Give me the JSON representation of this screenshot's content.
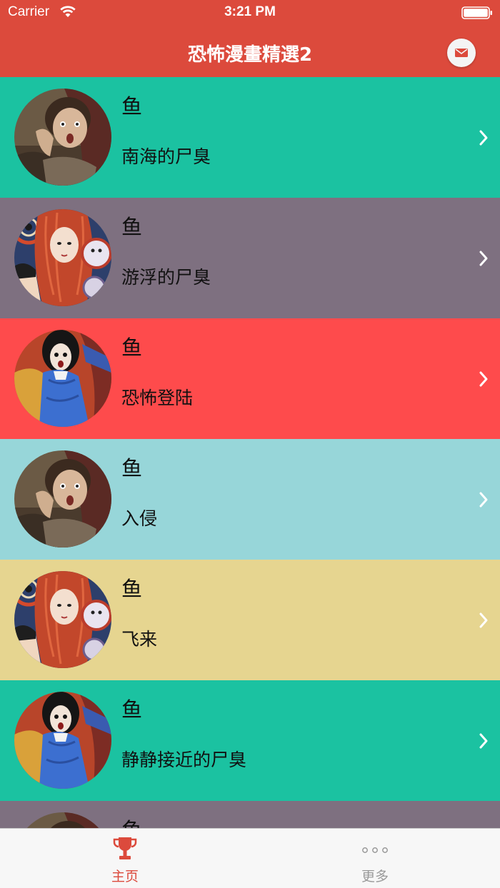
{
  "status_bar": {
    "carrier": "Carrier",
    "time": "3:21 PM"
  },
  "nav": {
    "title": "恐怖漫畫精選2",
    "mail_icon": "mail-icon"
  },
  "colors": {
    "brand_red": "#dc4a3c",
    "row_teal": "#1bc2a1",
    "row_purple_gray": "#7e7080",
    "row_red": "#fe4b4c",
    "row_light_blue": "#97d6d9",
    "row_sand": "#e6d590"
  },
  "list": {
    "items": [
      {
        "title": "鱼",
        "subtitle": "南海的尸臭",
        "color": "#1bc2a1",
        "avatar": "girl-screaming"
      },
      {
        "title": "鱼",
        "subtitle": "游浮的尸臭",
        "color": "#7e7080",
        "avatar": "spiral-redhead"
      },
      {
        "title": "鱼",
        "subtitle": "恐怖登陆",
        "color": "#fe4b4c",
        "avatar": "girl-blue-dress"
      },
      {
        "title": "鱼",
        "subtitle": "入侵",
        "color": "#97d6d9",
        "avatar": "girl-screaming"
      },
      {
        "title": "鱼",
        "subtitle": "飞来",
        "color": "#e6d590",
        "avatar": "spiral-redhead"
      },
      {
        "title": "鱼",
        "subtitle": "静静接近的尸臭",
        "color": "#1bc2a1",
        "avatar": "girl-blue-dress"
      },
      {
        "title": "鱼",
        "subtitle": "",
        "color": "#7e7080",
        "avatar": "girl-screaming"
      }
    ]
  },
  "tab_bar": {
    "home_label": "主页",
    "home_icon": "trophy-icon",
    "more_label": "更多",
    "more_icon": "more-dots-icon"
  }
}
